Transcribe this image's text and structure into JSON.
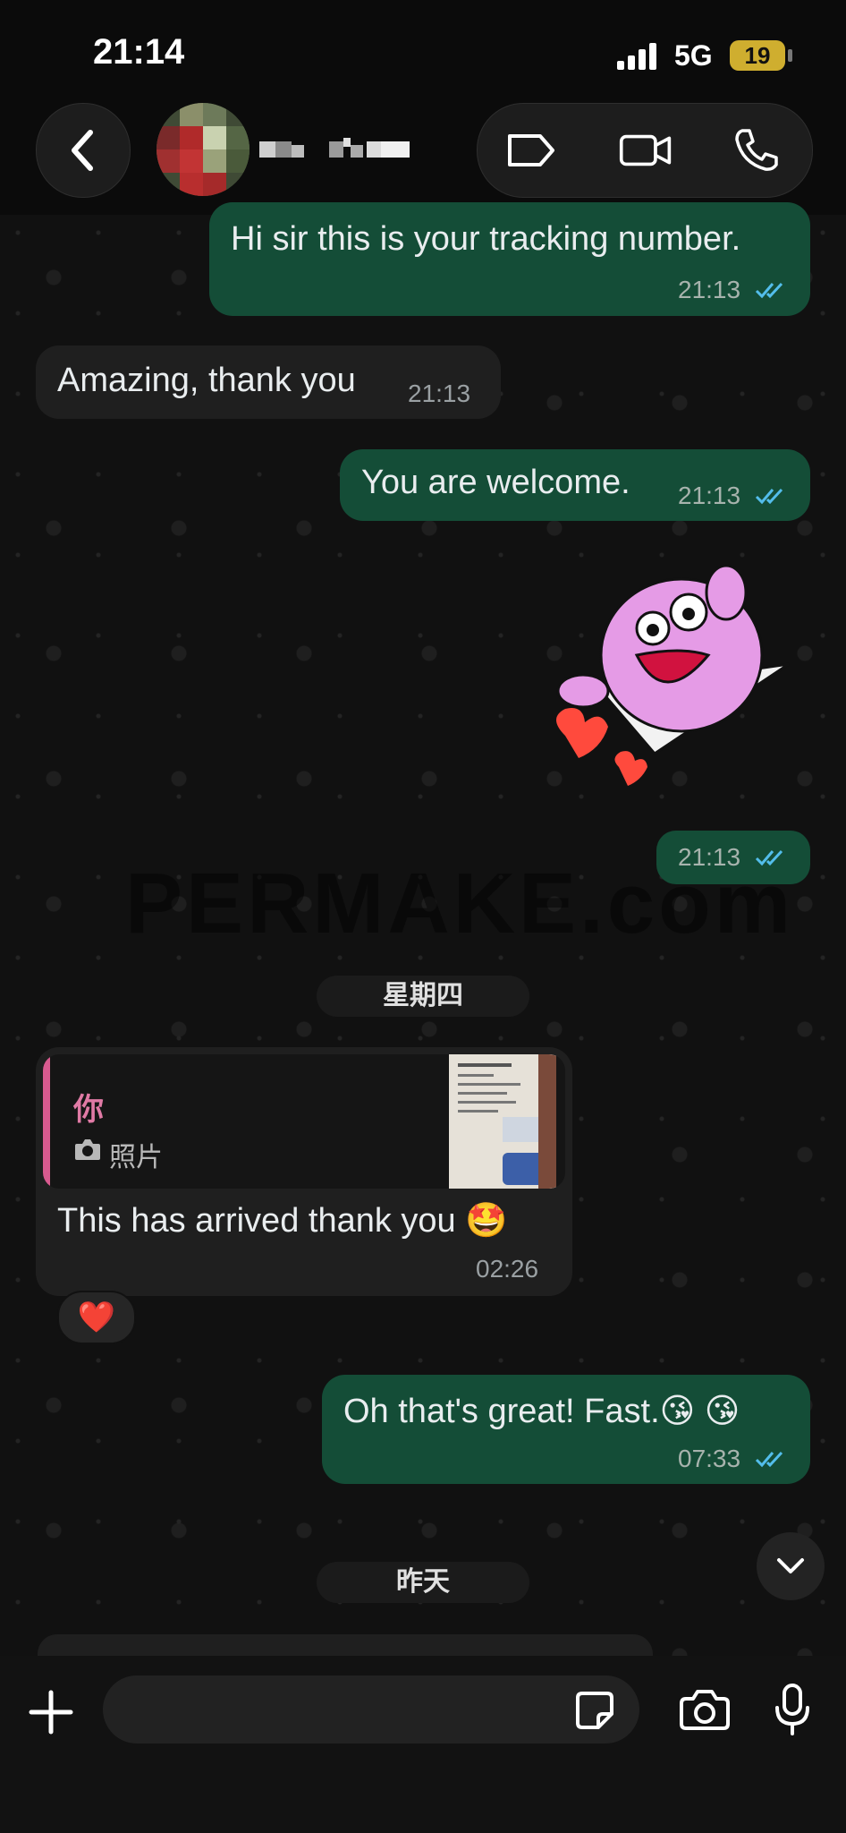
{
  "status_bar": {
    "time": "21:14",
    "network": "5G",
    "battery": "19"
  },
  "header": {
    "back_icon": "chevron-left-icon",
    "actions": [
      "label-icon",
      "video-call-icon",
      "voice-call-icon"
    ]
  },
  "messages": [
    {
      "text": "Hi sir this is your tracking number.",
      "time": "21:13"
    },
    {
      "text": "Amazing, thank you",
      "time": "21:13"
    },
    {
      "text": "You are welcome.",
      "time": "21:13"
    },
    {
      "sticker": "pink-blob-paper-plane-sticker",
      "time": "21:13"
    },
    {
      "quote_author": "你",
      "quote_type": "照片",
      "text": "This has arrived thank you 🤩",
      "time": "02:26",
      "reaction": "❤️"
    },
    {
      "text": "Oh that's great! Fast.😘 😘",
      "time": "07:33"
    }
  ],
  "date_separators": {
    "thursday": "星期四",
    "yesterday": "昨天"
  },
  "composer": {
    "placeholder": ""
  },
  "colors": {
    "outgoing_bubble": "#144d37",
    "incoming_bubble": "#1f1f1f",
    "read_ticks": "#53bdeb",
    "quote_accent": "#d85a8f"
  }
}
